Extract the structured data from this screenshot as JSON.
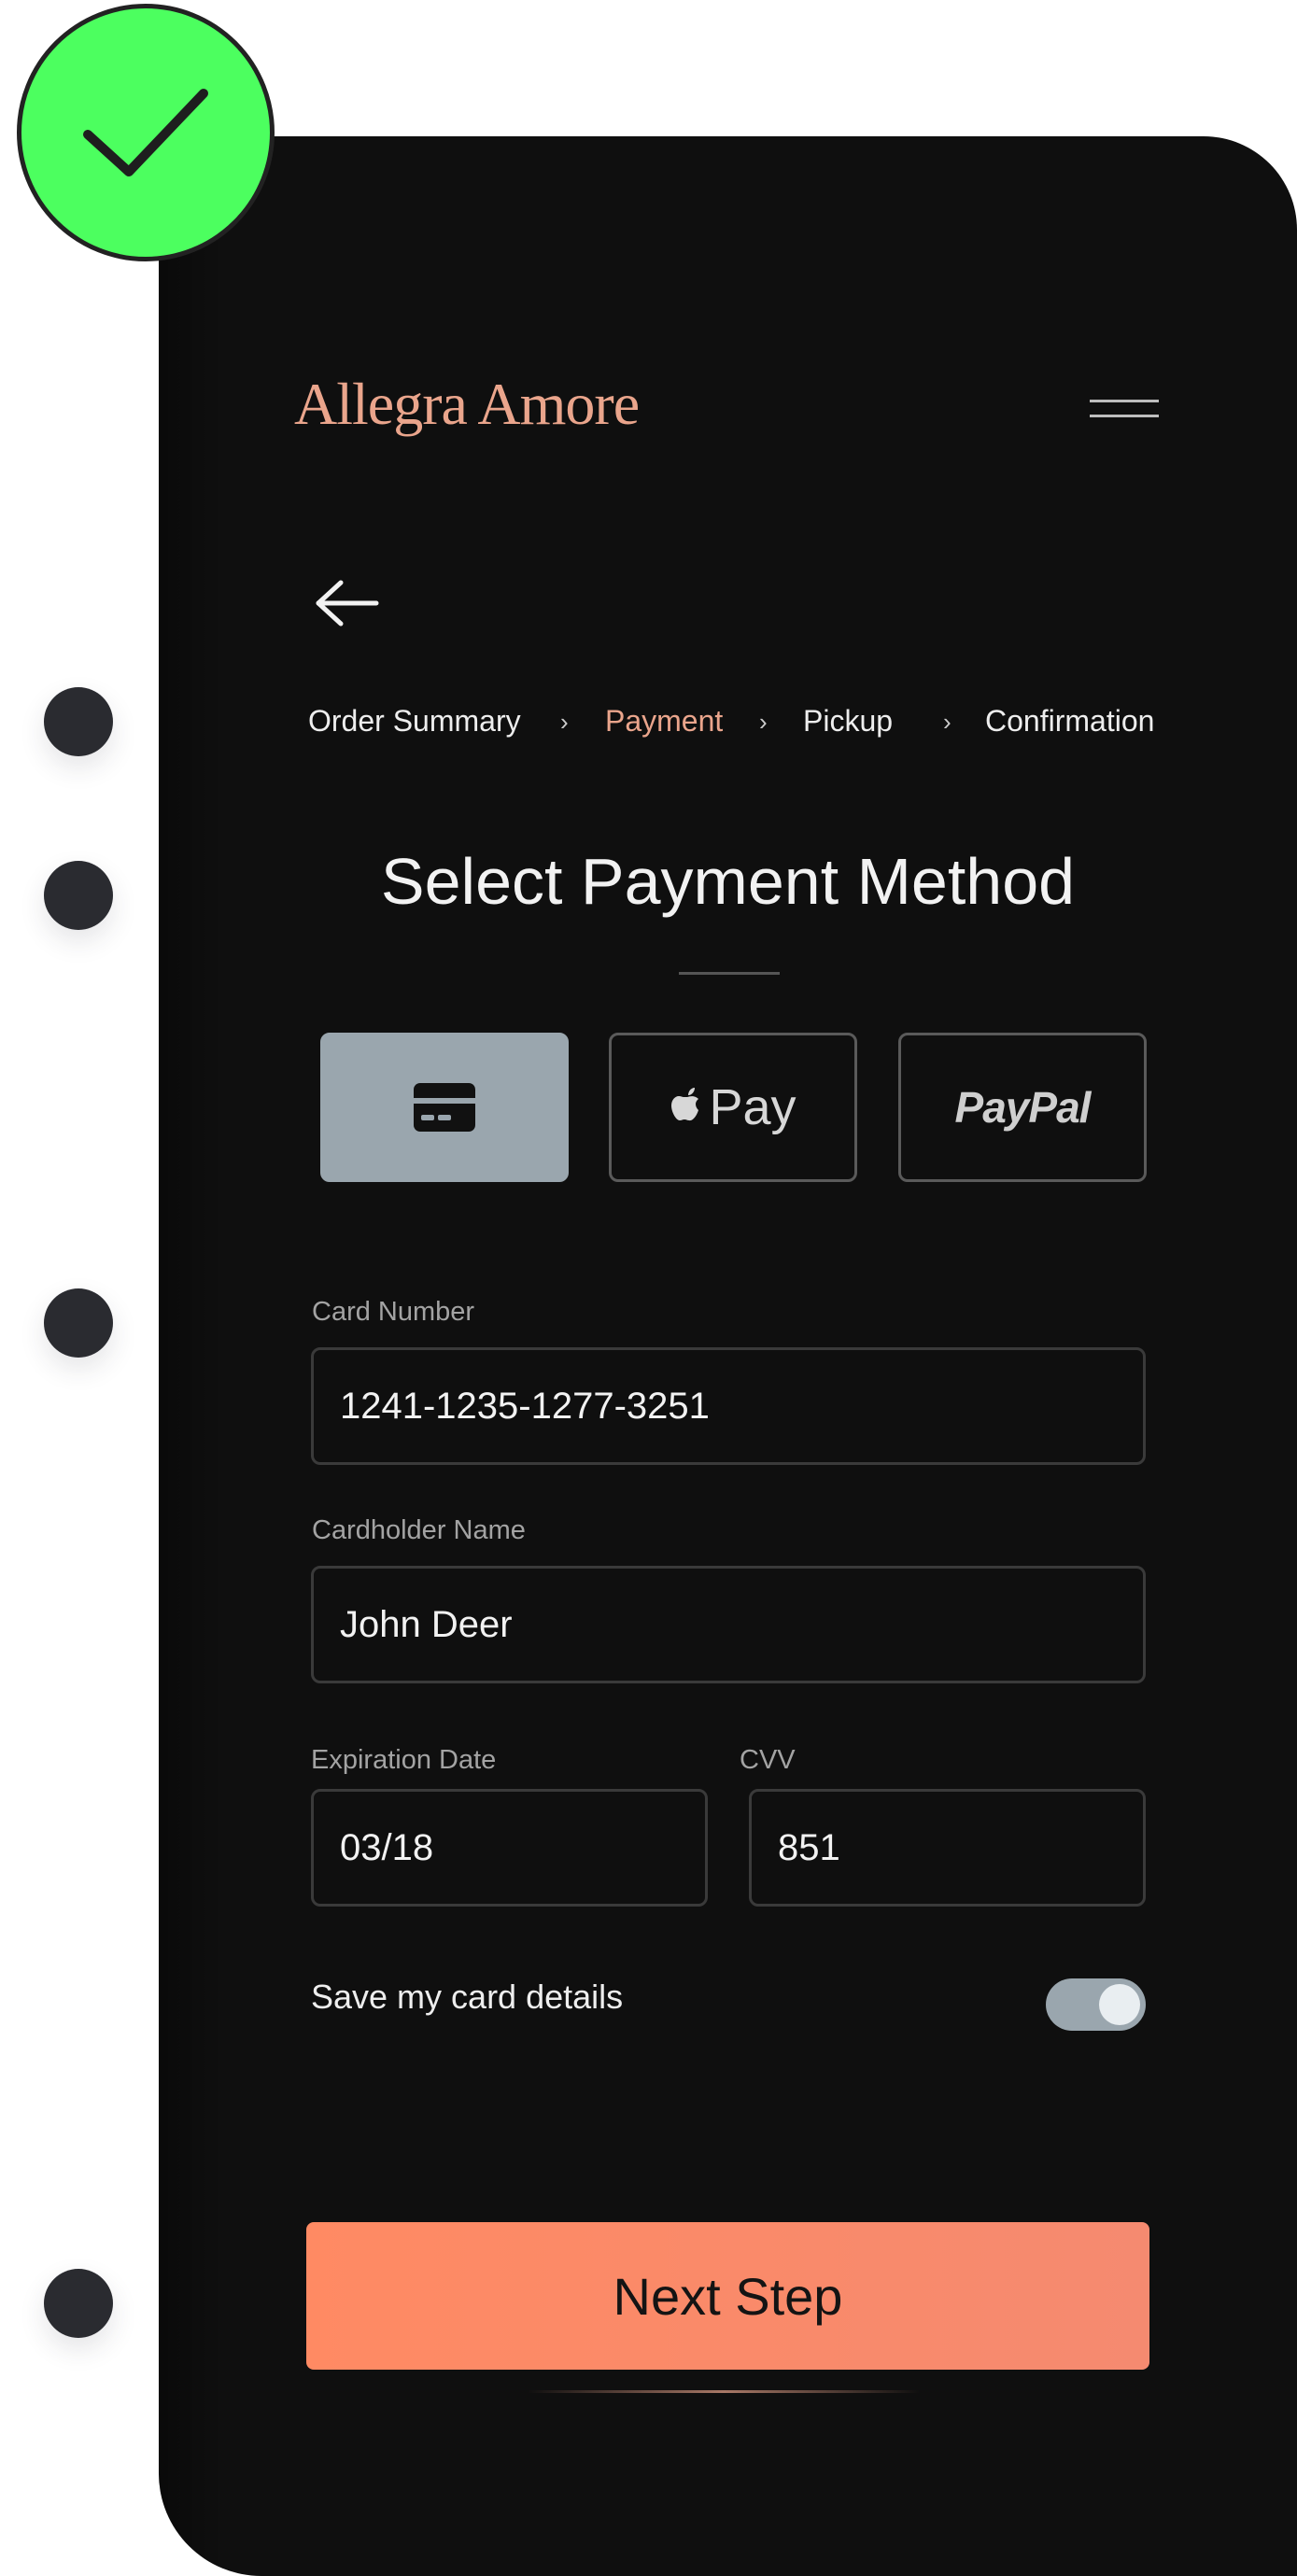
{
  "brand": {
    "name": "Allegra Amore"
  },
  "nav": {
    "menu_icon": "hamburger-icon",
    "back_icon": "arrow-left-icon"
  },
  "steps": [
    {
      "label": "Order Summary",
      "active": false
    },
    {
      "label": "Payment",
      "active": true
    },
    {
      "label": "Pickup",
      "active": false
    },
    {
      "label": "Confirmation",
      "active": false
    }
  ],
  "page": {
    "title": "Select Payment Method"
  },
  "payment_methods": {
    "card": {
      "icon": "credit-card-icon",
      "selected": true
    },
    "apple_pay": {
      "icon": "apple-icon",
      "label": "Pay",
      "selected": false
    },
    "paypal": {
      "label": "PayPal",
      "selected": false
    }
  },
  "form": {
    "card_number": {
      "label": "Card Number",
      "value": "1241-1235-1277-3251"
    },
    "cardholder": {
      "label": "Cardholder Name",
      "value": "John Deer"
    },
    "expiration": {
      "label": "Expiration Date",
      "value": "03/18"
    },
    "cvv": {
      "label": "CVV",
      "value": "851"
    },
    "save_card": {
      "label": "Save my card details",
      "on": true
    }
  },
  "actions": {
    "next_label": "Next Step"
  },
  "colors": {
    "accent": "#eaa58c",
    "button": "#ff8a63",
    "selected": "#9aa6ae",
    "background": "#0f0f0f",
    "success": "#4cff5f"
  }
}
